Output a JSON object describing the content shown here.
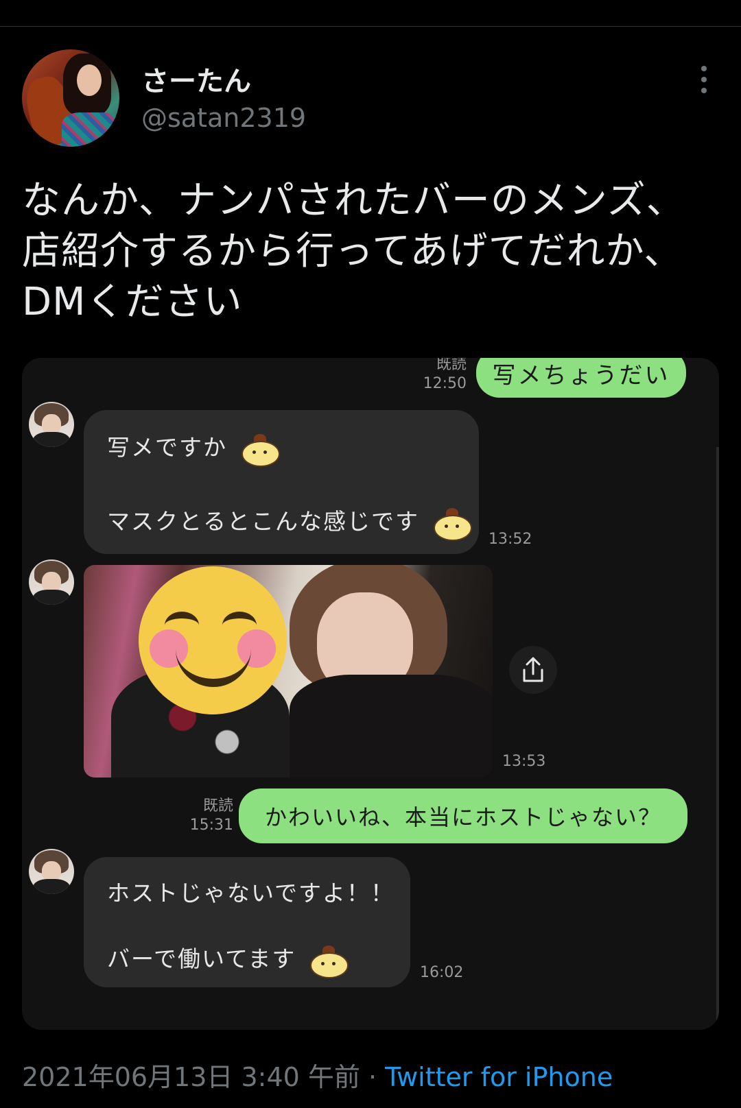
{
  "author": {
    "display_name": "さーたん",
    "handle": "@satan2319"
  },
  "tweet": {
    "lines": [
      "なんか、ナンパされたバーのメンズ、",
      "店紹介するから行ってあげてだれか、",
      "DMください"
    ],
    "date": "2021年06月13日 3:40 午前",
    "separator": " · ",
    "source": "Twitter for iPhone"
  },
  "chat": {
    "messages": [
      {
        "direction": "out",
        "text": "写メちょうだい",
        "read": "既読",
        "time": "12:50"
      },
      {
        "direction": "in",
        "lines": [
          "写メですか",
          "マスクとるとこんな感じです"
        ],
        "time": "13:52"
      },
      {
        "direction": "in",
        "type": "image",
        "time": "13:53"
      },
      {
        "direction": "out",
        "text": "かわいいね、本当にホストじゃない？",
        "read": "既読",
        "time": "15:31"
      },
      {
        "direction": "in",
        "lines": [
          "ホストじゃないですよ！！",
          "バーで働いてます"
        ],
        "time": "16:02"
      }
    ]
  },
  "colors": {
    "background": "#000000",
    "out_bubble": "#8de07f",
    "in_bubble": "#2b2b2b",
    "link": "#1d9bf0",
    "muted": "#71767b"
  },
  "icons": [
    "more-vertical-icon",
    "share-icon",
    "pompompurin-sticker-icon",
    "smiling-face-emoji"
  ]
}
